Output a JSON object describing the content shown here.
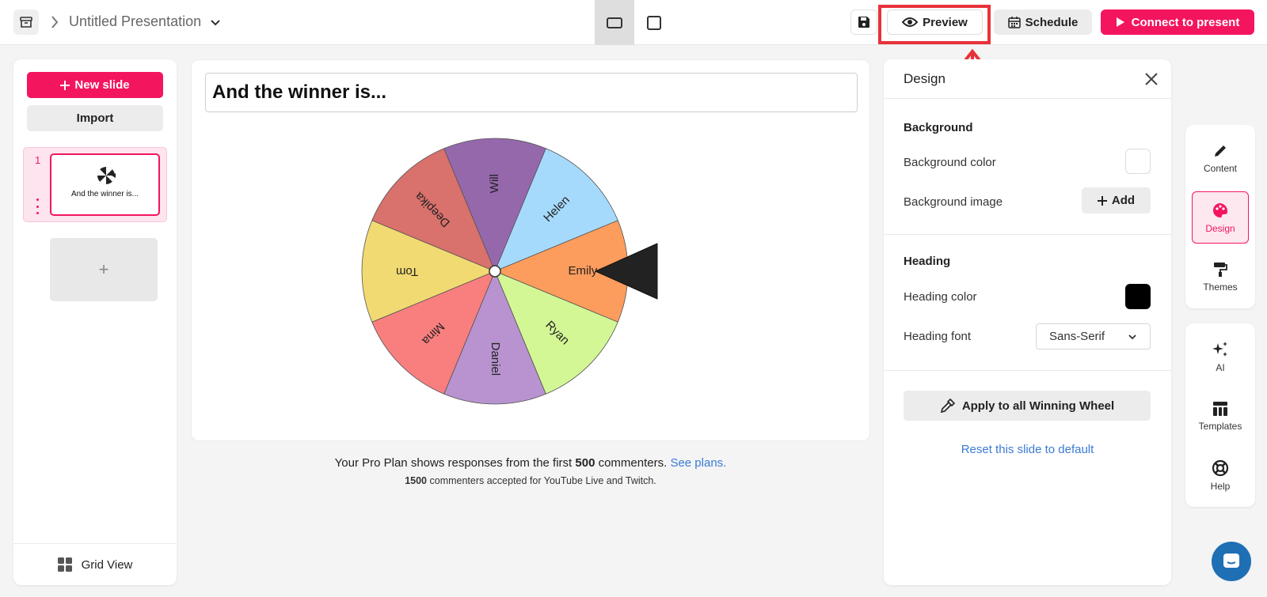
{
  "topbar": {
    "presentation_title": "Untitled Presentation",
    "preview_label": "Preview",
    "schedule_label": "Schedule",
    "connect_label": "Connect to present"
  },
  "sidebar": {
    "new_slide_label": "New slide",
    "import_label": "Import",
    "slides": [
      {
        "number": "1",
        "caption": "And the winner is..."
      }
    ],
    "add_slide_glyph": "+",
    "grid_view_label": "Grid View"
  },
  "slide": {
    "heading": "And the winner is...",
    "wheel": {
      "segments": [
        {
          "name": "Emily",
          "color": "#fc9c5d"
        },
        {
          "name": "Ryan",
          "color": "#d4f796"
        },
        {
          "name": "Daniel",
          "color": "#b893cf"
        },
        {
          "name": "Mina",
          "color": "#f97f7f"
        },
        {
          "name": "Tom",
          "color": "#f2da72"
        },
        {
          "name": "Deepika",
          "color": "#d9716c"
        },
        {
          "name": "Will",
          "color": "#9568ac"
        },
        {
          "name": "Helen",
          "color": "#a6dafc"
        }
      ]
    }
  },
  "plan_note": {
    "prefix": "Your Pro Plan shows responses from the first ",
    "count": "500",
    "middle": " commenters. ",
    "link": "See plans.",
    "sub_count": "1500",
    "sub_text": " commenters accepted for YouTube Live and Twitch."
  },
  "design_panel": {
    "title": "Design",
    "background_section": "Background",
    "background_color_label": "Background color",
    "background_color": "#ffffff",
    "background_image_label": "Background image",
    "add_label": "Add",
    "heading_section": "Heading",
    "heading_color_label": "Heading color",
    "heading_color": "#000000",
    "heading_font_label": "Heading font",
    "heading_font_value": "Sans-Serif",
    "apply_label": "Apply to all Winning Wheel",
    "reset_label": "Reset this slide to default"
  },
  "rail": {
    "content_label": "Content",
    "design_label": "Design",
    "themes_label": "Themes",
    "ai_label": "AI",
    "templates_label": "Templates",
    "help_label": "Help"
  },
  "colors": {
    "accent": "#f4155f",
    "highlight": "#e8323a",
    "link": "#3a7bd5"
  }
}
